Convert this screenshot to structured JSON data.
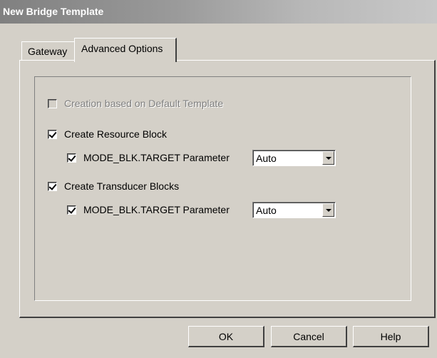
{
  "window": {
    "title": "New Bridge Template"
  },
  "tabs": [
    {
      "label": "Gateway",
      "active": false
    },
    {
      "label": "Advanced Options",
      "active": true
    }
  ],
  "options": {
    "default_template": {
      "label": "Creation based on Default Template",
      "checked": false,
      "disabled": true
    },
    "resource_block": {
      "label": "Create Resource Block",
      "checked": true,
      "mode_param": {
        "label": "MODE_BLK.TARGET Parameter",
        "checked": true,
        "value": "Auto"
      }
    },
    "transducer_blocks": {
      "label": "Create Transducer Blocks",
      "checked": true,
      "mode_param": {
        "label": "MODE_BLK.TARGET Parameter",
        "checked": true,
        "value": "Auto"
      }
    }
  },
  "buttons": {
    "ok": "OK",
    "cancel": "Cancel",
    "help": "Help"
  }
}
